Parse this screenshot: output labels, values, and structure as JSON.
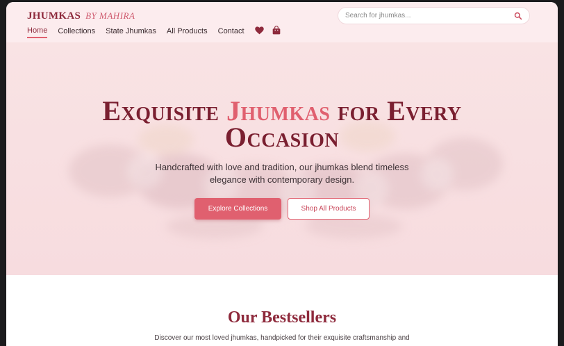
{
  "header": {
    "brand": "JHUMKAS",
    "brand_by": "BY MAHIRA",
    "search_placeholder": "Search for jhumkas...",
    "nav": {
      "home": "Home",
      "collections": "Collections",
      "state_jhumkas": "State Jhumkas",
      "all_products": "All Products",
      "contact": "Contact"
    },
    "icons": [
      "heart-icon",
      "bag-icon",
      "search-icon"
    ]
  },
  "hero": {
    "title_part1": "Exquisite ",
    "title_accent": "Jhumkas",
    "title_part2": " for Every",
    "title_line2": "Occasion",
    "subtitle": "Handcrafted with love and tradition, our jhumkas blend timeless elegance with contemporary design.",
    "primary_button": "Explore Collections",
    "secondary_button": "Shop All Products"
  },
  "bestsellers": {
    "title": "Our Bestsellers",
    "subtitle": "Discover our most loved jhumkas, handpicked for their exquisite craftsmanship and"
  },
  "colors": {
    "accent": "#e0606f",
    "brand": "#8e2a3c",
    "hero_bg": "#f8e1e2"
  }
}
